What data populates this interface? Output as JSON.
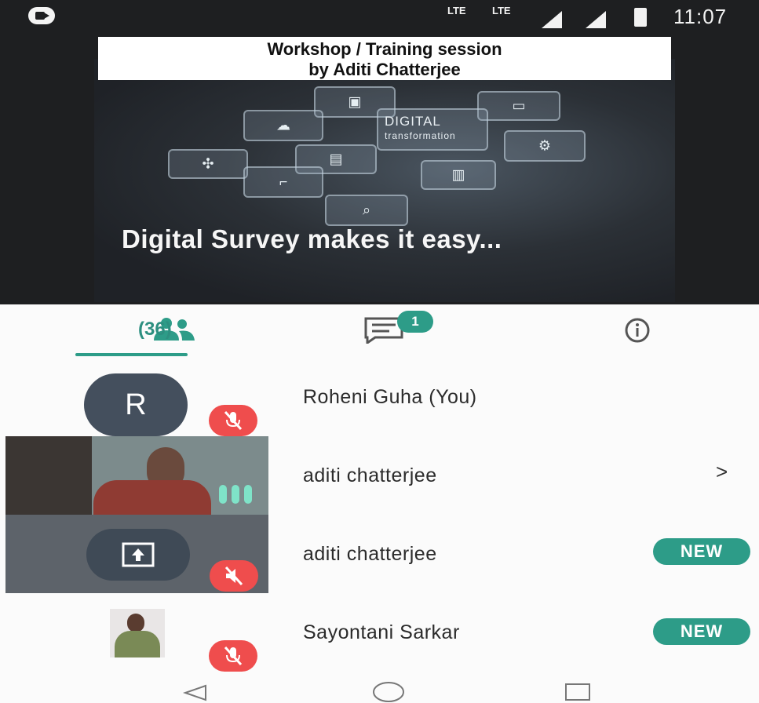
{
  "status_bar": {
    "lte_1": "LTE",
    "lte_2": "LTE",
    "time": "11:07"
  },
  "video": {
    "title_line_1": "Workshop / Training session",
    "title_line_2": "by Aditi Chatterjee",
    "slide_word_1": "DIGITAL",
    "slide_word_2": "transformation",
    "caption": "Digital Survey makes it easy..."
  },
  "tabs": {
    "participants_count": "(36)",
    "chat_badge": "1"
  },
  "participants": [
    {
      "name": "Roheni Guha (You)",
      "avatar_letter": "R",
      "muted": true
    },
    {
      "name": "aditi chatterjee",
      "has_chevron": true,
      "chevron": ">"
    },
    {
      "name": "aditi chatterjee",
      "badge": "NEW",
      "muted": true
    },
    {
      "name": "Sayontani Sarkar",
      "badge": "NEW",
      "muted": true
    }
  ],
  "colors": {
    "accent": "#2d9c88",
    "mute_red": "#ef4d4d",
    "avatar_bg": "#444f5d"
  },
  "icons": [
    "video-call-icon",
    "people-icon",
    "chat-icon",
    "info-icon",
    "mic-off-icon",
    "share-screen-icon",
    "back-icon",
    "home-icon",
    "recents-icon"
  ]
}
